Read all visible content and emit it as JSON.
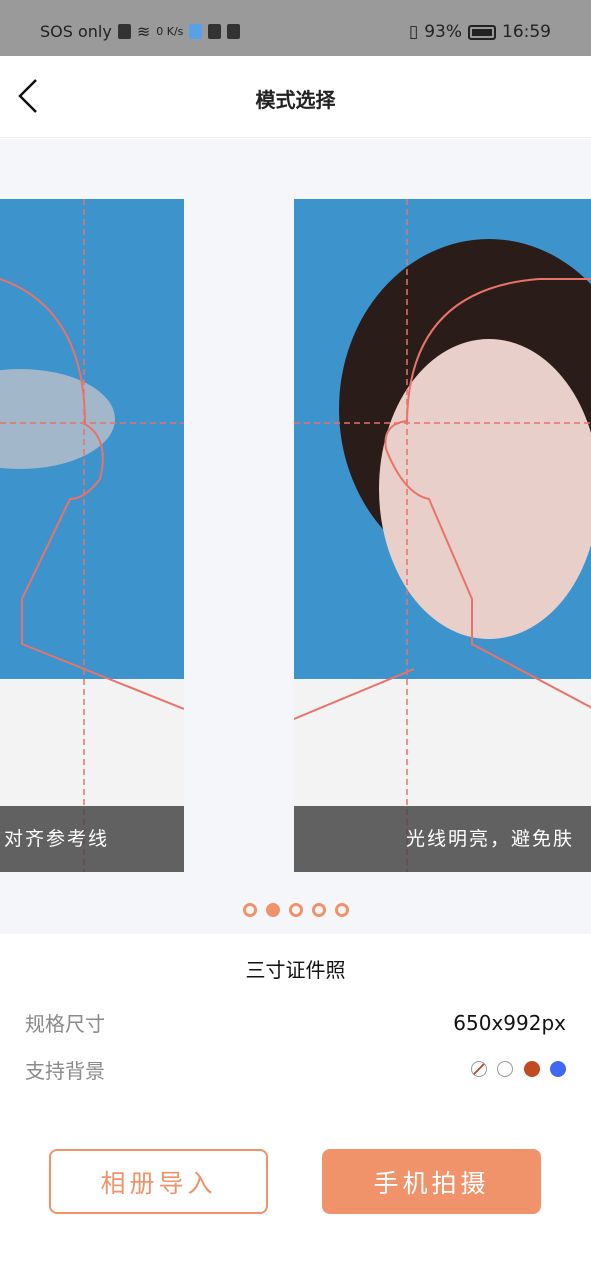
{
  "status_bar": {
    "carrier": "SOS only",
    "net_speed": "0 K/s",
    "battery": "93%",
    "time": "16:59"
  },
  "nav": {
    "title": "模式选择"
  },
  "carousel": {
    "slides": [
      {
        "caption": "对齐参考线"
      },
      {
        "caption": "光线明亮，避免肤"
      }
    ],
    "page_count": 5,
    "active_index": 1
  },
  "spec": {
    "name": "三寸证件照",
    "size_label": "规格尺寸",
    "size_value": "650x992px",
    "bg_label": "支持背景",
    "backgrounds": [
      {
        "name": "transparent",
        "color": "#ffffff"
      },
      {
        "name": "white",
        "color": "#ffffff"
      },
      {
        "name": "red",
        "color": "#c04a22"
      },
      {
        "name": "blue",
        "color": "#4168f0"
      }
    ]
  },
  "buttons": {
    "album": "相册导入",
    "camera": "手机拍摄"
  },
  "colors": {
    "accent": "#f0936b",
    "guide": "#e8736a",
    "photo_bg": "#3d93cc"
  }
}
